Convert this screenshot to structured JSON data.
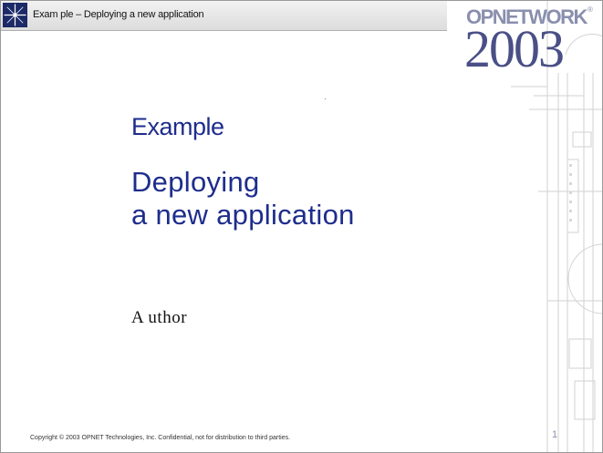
{
  "header": {
    "title": "Exam ple – Deploying a new application",
    "logo_icon": "star-burst-icon"
  },
  "brand": {
    "wordmark": "OPNETWORK",
    "trademark": "®",
    "year": "2003"
  },
  "content": {
    "heading": "Example",
    "title_line1": "Deploying",
    "title_line2": "a new application",
    "author": "A uthor"
  },
  "footer": {
    "copyright": "Copyright © 2003 OPNET Technologies, Inc.  Confidential, not for distribution to third parties.",
    "page_number": "1"
  },
  "colors": {
    "title_blue": "#1e2d8c",
    "logo_navy": "#4a4f86",
    "logo_grey": "#8a8fae",
    "header_star_bg": "#1d2a68"
  }
}
